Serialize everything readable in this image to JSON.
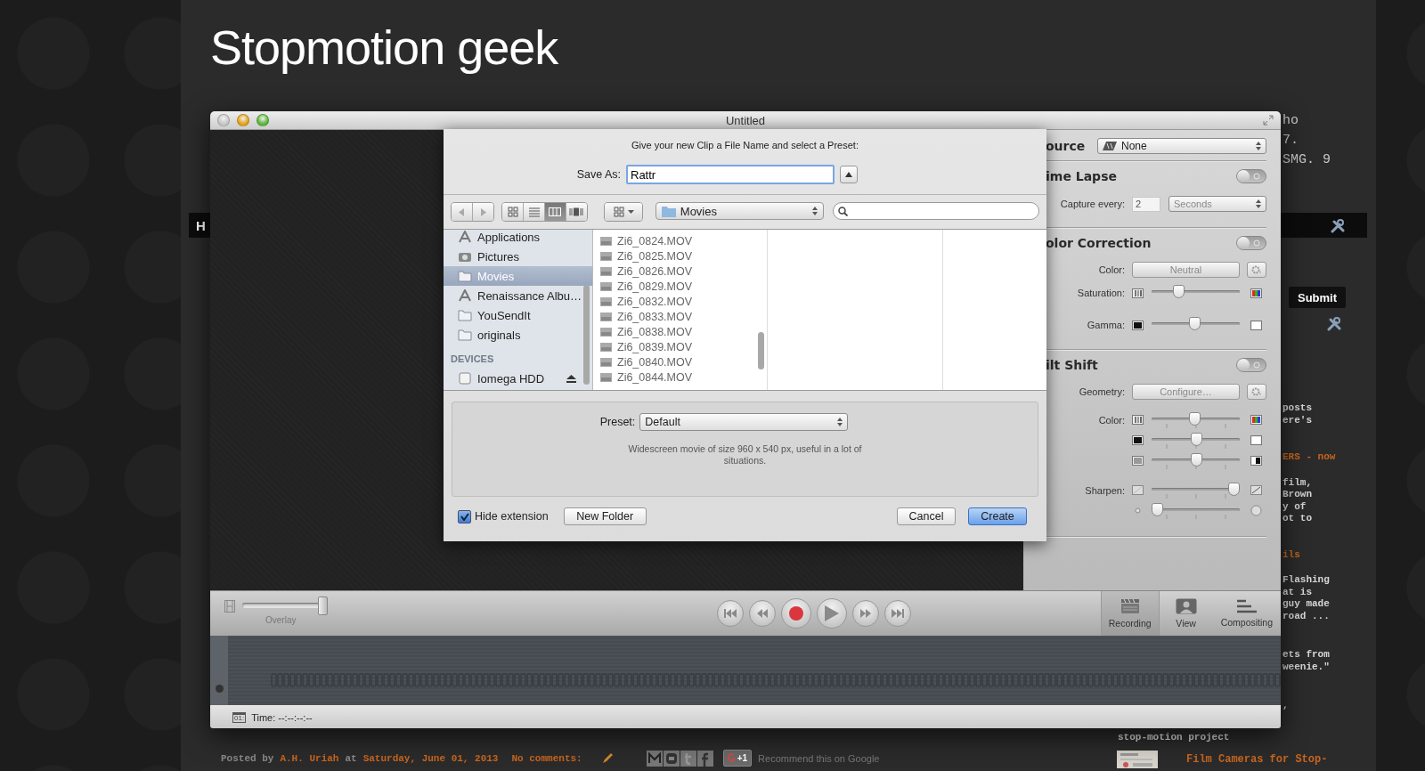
{
  "blog": {
    "title": "Stopmotion geek",
    "top_lines": [
      "ho",
      "7.",
      "SMG. 9"
    ],
    "nav_label": "H",
    "submit": "Submit",
    "sidebar_fragments": [
      {
        "kind": "text",
        "lines": [
          "posts",
          "ere's"
        ]
      },
      {
        "kind": "link",
        "lines": [
          "ERS - now"
        ]
      },
      {
        "kind": "text",
        "lines": [
          "film,",
          "Brown",
          "y of",
          "ot to"
        ]
      },
      {
        "kind": "link",
        "lines": [
          "ils"
        ]
      },
      {
        "kind": "text",
        "lines": [
          "Flashing",
          "at is",
          "guy made",
          "road ..."
        ]
      },
      {
        "kind": "text",
        "lines": [
          "ets from",
          "weenie.\""
        ]
      },
      {
        "kind": "text",
        "lines": [
          ","
        ]
      },
      {
        "kind": "full",
        "lines": [
          "stop-motion project"
        ]
      }
    ],
    "related_post": "Film Cameras for Stop-",
    "footer": {
      "posted_by": "Posted by",
      "author": "A.H. Uriah",
      "at": "at",
      "date": "Saturday, June 01, 2013",
      "comments": "No comments:",
      "share": [
        {
          "kind": "email"
        },
        {
          "kind": "blog"
        },
        {
          "kind": "twitter"
        },
        {
          "kind": "facebook"
        }
      ],
      "plus_one": "+1",
      "recommend": "Recommend this on Google"
    }
  },
  "window": {
    "title": "Untitled",
    "inspector": [
      {
        "kind": "select",
        "title": "ource",
        "value": "None"
      },
      {
        "kind": "toggle",
        "title": "ime Lapse",
        "on": false,
        "rows": [
          {
            "kind": "capture",
            "label": "Capture every:",
            "value": "2",
            "unit": "Seconds",
            "disabled": true
          }
        ]
      },
      {
        "kind": "toggle",
        "title": "olor Correction",
        "on": false,
        "rows": [
          {
            "kind": "button",
            "label": "Color:",
            "value": "Neutral",
            "disabled": true
          },
          {
            "kind": "slider",
            "label": "Saturation:",
            "icons": {
              "kind": "color"
            },
            "ticks": false,
            "level": 0.3
          },
          {
            "kind": "slider",
            "label": "Gamma:",
            "icons": {
              "kind": "gamma"
            },
            "ticks": false,
            "level": 0.48
          }
        ]
      },
      {
        "kind": "toggle",
        "title": "ilt Shift",
        "on": false,
        "rows": [
          {
            "kind": "button",
            "label": "Geometry:",
            "value": "Configure…",
            "disabled": true
          },
          {
            "kind": "slider",
            "label": "Color:",
            "icons": {
              "kind": "color"
            },
            "ticks": true,
            "level": 0.48
          },
          {
            "kind": "slider",
            "icons": {
              "kind": "gamma"
            },
            "ticks": true,
            "level": 0.5
          },
          {
            "kind": "slider",
            "icons": {
              "kind": "contrast"
            },
            "ticks": true,
            "level": 0.51
          },
          {
            "kind": "slider",
            "label": "Sharpen:",
            "icons": {
              "kind": "sharpen"
            },
            "ticks": true,
            "level": 0.93
          },
          {
            "kind": "slider",
            "icons": {
              "kind": "blur"
            },
            "ticks": true,
            "level": 0.06
          }
        ]
      }
    ],
    "save_dialog": {
      "prompt": "Give your new Clip a File Name and select a Preset:",
      "save_as_label": "Save As:",
      "filename": "Rattr",
      "location": "Movies",
      "view_modes": [
        {
          "kind": "icons",
          "selected": false
        },
        {
          "kind": "list",
          "selected": false
        },
        {
          "kind": "columns",
          "selected": true
        },
        {
          "kind": "coverflow",
          "selected": false
        }
      ],
      "sidebar": [
        {
          "kind": "apps",
          "label": "Applications",
          "selected": false
        },
        {
          "kind": "camera",
          "label": "Pictures",
          "selected": false
        },
        {
          "kind": "folder",
          "label": "Movies",
          "selected": true
        },
        {
          "kind": "apps",
          "label": "Renaissance Albu…",
          "selected": false
        },
        {
          "kind": "folder",
          "label": "YouSendIt",
          "selected": false
        },
        {
          "kind": "folder",
          "label": "originals",
          "selected": false
        }
      ],
      "devices_heading": "DEVICES",
      "devices": [
        {
          "label": "Iomega HDD"
        }
      ],
      "files": [
        "Zi6_0824.MOV",
        "Zi6_0825.MOV",
        "Zi6_0826.MOV",
        "Zi6_0829.MOV",
        "Zi6_0832.MOV",
        "Zi6_0833.MOV",
        "Zi6_0838.MOV",
        "Zi6_0839.MOV",
        "Zi6_0840.MOV",
        "Zi6_0844.MOV"
      ],
      "preset_label": "Preset:",
      "preset": "Default",
      "preset_description": "Widescreen movie of size 960 x 540 px, useful in a lot of situations.",
      "hide_extension": {
        "label": "Hide extension",
        "checked": true
      },
      "new_folder": "New Folder",
      "cancel": "Cancel",
      "create": "Create"
    },
    "toolbar": {
      "overlay": {
        "label": "Overlay",
        "level": 0.95
      },
      "transport": [
        {
          "kind": "start"
        },
        {
          "kind": "rewind"
        },
        {
          "kind": "record"
        },
        {
          "kind": "play"
        },
        {
          "kind": "forward"
        },
        {
          "kind": "end"
        }
      ],
      "modes": [
        {
          "kind": "clapper",
          "label": "Recording",
          "selected": true
        },
        {
          "kind": "view",
          "label": "View",
          "selected": false
        },
        {
          "kind": "layers",
          "label": "Compositing",
          "selected": false
        }
      ]
    },
    "status": {
      "badge": "01:",
      "time": "Time: --:--:--:--"
    }
  }
}
